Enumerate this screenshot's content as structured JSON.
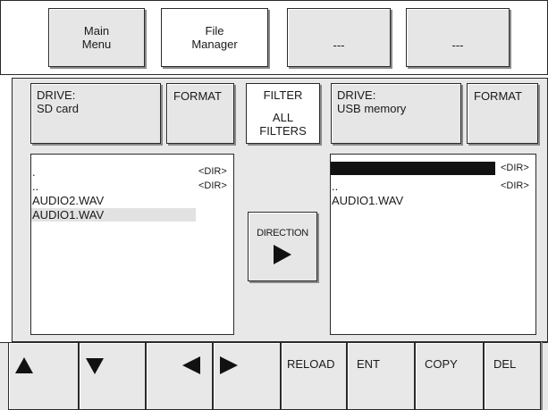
{
  "tabs": [
    {
      "label_line1": "Main",
      "label_line2": "Menu"
    },
    {
      "label_line1": "File",
      "label_line2": "Manager"
    },
    {
      "label": "---"
    },
    {
      "label": "---"
    }
  ],
  "left_drive": {
    "label": "DRIVE:",
    "value": "SD card"
  },
  "right_drive": {
    "label": "DRIVE:",
    "value": "USB memory"
  },
  "format_left": "FORMAT",
  "format_right": "FORMAT",
  "filter": {
    "title": "FILTER",
    "value_line1": "ALL",
    "value_line2": "FILTERS"
  },
  "direction": {
    "label": "DIRECTION",
    "arrow_icon": "right-triangle-icon"
  },
  "left_list": [
    {
      "name": ".",
      "tag": "<DIR>"
    },
    {
      "name": "..",
      "tag": "<DIR>"
    },
    {
      "name": "AUDIO2.WAV",
      "tag": ""
    },
    {
      "name": "AUDIO1.WAV",
      "tag": "",
      "selected": true
    }
  ],
  "right_list": [
    {
      "name": ".",
      "tag": "<DIR>",
      "cursor": true
    },
    {
      "name": "..",
      "tag": "<DIR>"
    },
    {
      "name": "AUDIO1.WAV",
      "tag": ""
    }
  ],
  "toolbar": {
    "up_icon": "up-triangle-icon",
    "down_icon": "down-triangle-icon",
    "left_icon": "left-triangle-icon",
    "right_icon": "right-triangle-icon",
    "reload": "RELOAD",
    "ent": "ENT",
    "copy": "COPY",
    "del": "DEL"
  },
  "colors": {
    "selection": "#e2e2e2",
    "cursor": "#111111",
    "panel": "#e8e8e8"
  }
}
